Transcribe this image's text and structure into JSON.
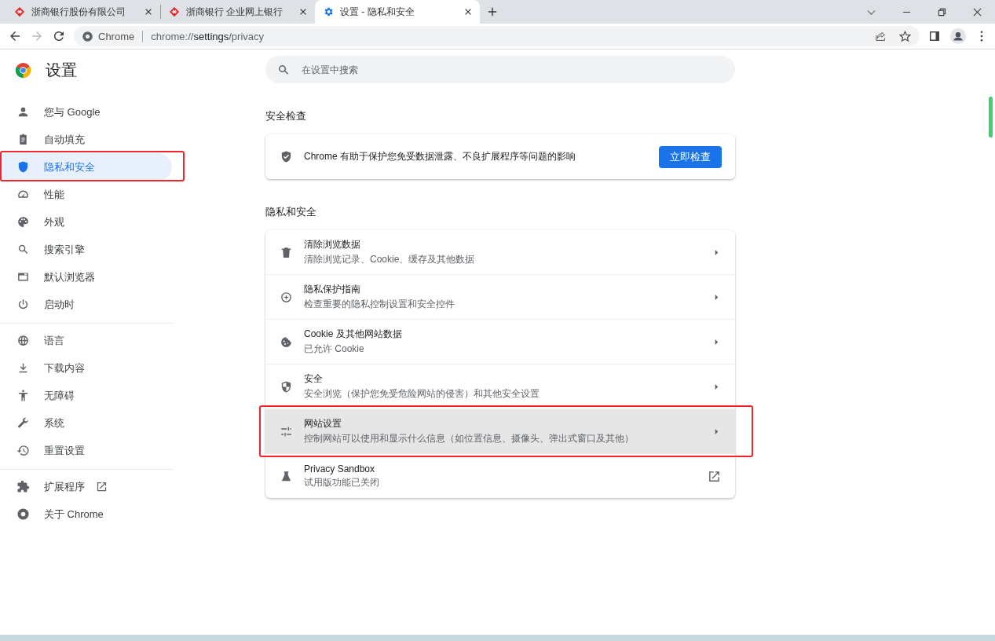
{
  "tabs": [
    {
      "title": "浙商银行股份有限公司",
      "selected": false
    },
    {
      "title": "浙商银行 企业网上银行",
      "selected": false
    },
    {
      "title": "设置 - 隐私和安全",
      "selected": true
    }
  ],
  "address_bar": {
    "site_label": "Chrome",
    "url_prefix": "chrome://",
    "url_host": "settings",
    "url_path": "/privacy"
  },
  "sidebar": {
    "title": "设置",
    "groups": [
      [
        {
          "label": "您与 Google",
          "selected": false,
          "annotated": false
        },
        {
          "label": "自动填充",
          "selected": false,
          "annotated": false
        },
        {
          "label": "隐私和安全",
          "selected": true,
          "annotated": true
        },
        {
          "label": "性能",
          "selected": false,
          "annotated": false
        },
        {
          "label": "外观",
          "selected": false,
          "annotated": false
        },
        {
          "label": "搜索引擎",
          "selected": false,
          "annotated": false
        },
        {
          "label": "默认浏览器",
          "selected": false,
          "annotated": false
        },
        {
          "label": "启动时",
          "selected": false,
          "annotated": false
        }
      ],
      [
        {
          "label": "语言",
          "selected": false,
          "annotated": false
        },
        {
          "label": "下载内容",
          "selected": false,
          "annotated": false
        },
        {
          "label": "无障碍",
          "selected": false,
          "annotated": false
        },
        {
          "label": "系统",
          "selected": false,
          "annotated": false
        },
        {
          "label": "重置设置",
          "selected": false,
          "annotated": false
        }
      ],
      [
        {
          "label": "扩展程序",
          "selected": false,
          "annotated": false,
          "external": true
        },
        {
          "label": "关于 Chrome",
          "selected": false,
          "annotated": false,
          "external": false
        }
      ]
    ]
  },
  "search": {
    "placeholder": "在设置中搜索"
  },
  "safety_check": {
    "heading": "安全检查",
    "text": "Chrome 有助于保护您免受数据泄露、不良扩展程序等问题的影响",
    "button": "立即检查"
  },
  "privacy": {
    "heading": "隐私和安全",
    "rows": [
      {
        "title": "清除浏览数据",
        "subtitle": "清除浏览记录、Cookie、缓存及其他数据",
        "kind": "subpage",
        "highlighted": false,
        "annotated": false
      },
      {
        "title": "隐私保护指南",
        "subtitle": "检查重要的隐私控制设置和安全控件",
        "kind": "subpage",
        "highlighted": false,
        "annotated": false
      },
      {
        "title": "Cookie 及其他网站数据",
        "subtitle": "已允许 Cookie",
        "kind": "subpage",
        "highlighted": false,
        "annotated": false
      },
      {
        "title": "安全",
        "subtitle": "安全浏览（保护您免受危险网站的侵害）和其他安全设置",
        "kind": "subpage",
        "highlighted": false,
        "annotated": false
      },
      {
        "title": "网站设置",
        "subtitle": "控制网站可以使用和显示什么信息（如位置信息、摄像头、弹出式窗口及其他）",
        "kind": "subpage",
        "highlighted": true,
        "annotated": true
      },
      {
        "title": "Privacy Sandbox",
        "subtitle": "试用版功能已关闭",
        "kind": "external",
        "highlighted": false,
        "annotated": false
      }
    ]
  }
}
